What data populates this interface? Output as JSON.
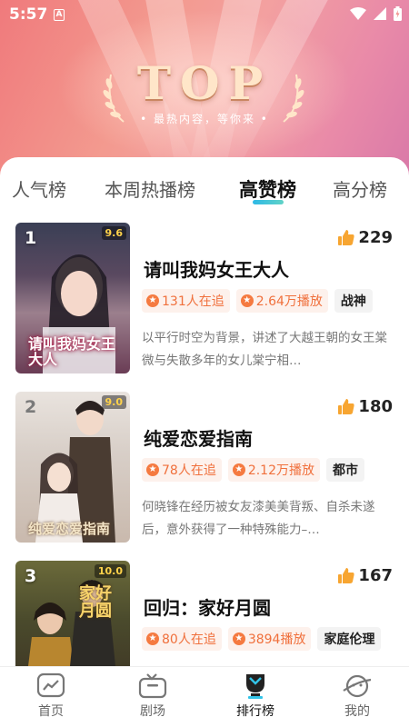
{
  "status_bar": {
    "time": "5:57",
    "notification_badge": "A"
  },
  "hero": {
    "title": "TOP",
    "subtitle": "• 最热内容，等你来 •"
  },
  "tabs": [
    {
      "label": "人气榜",
      "active": false
    },
    {
      "label": "本周热播榜",
      "active": false
    },
    {
      "label": "高赞榜",
      "active": true
    },
    {
      "label": "高分榜",
      "active": false
    }
  ],
  "items": [
    {
      "rank": "1",
      "score": "9.6",
      "cover_text": "请叫我妈女王大人",
      "likes": "229",
      "title": "请叫我妈女王大人",
      "followers": "131人在追",
      "plays": "2.64万播放",
      "genre": "战神",
      "desc": "以平行时空为背景，讲述了大越王朝的女王棠微与失散多年的女儿棠宁相…"
    },
    {
      "rank": "2",
      "score": "9.0",
      "cover_text": "纯爱恋爱指南",
      "likes": "180",
      "title": "纯爱恋爱指南",
      "followers": "78人在追",
      "plays": "2.12万播放",
      "genre": "都市",
      "desc": "何晓锋在经历被女友漆美美背叛、自杀未遂后，意外获得了一种特殊能力–…"
    },
    {
      "rank": "3",
      "score": "10.0",
      "cover_text": "家好月圆",
      "likes": "167",
      "title": "回归：家好月圆",
      "followers": "80人在追",
      "plays": "3894播放",
      "genre": "家庭伦理",
      "desc": ""
    }
  ],
  "bottom_nav": [
    {
      "label": "首页",
      "icon": "home-chart-icon",
      "active": false
    },
    {
      "label": "剧场",
      "icon": "tv-icon",
      "active": false
    },
    {
      "label": "排行榜",
      "icon": "ranking-trophy-icon",
      "active": true
    },
    {
      "label": "我的",
      "icon": "profile-planet-icon",
      "active": false
    }
  ],
  "colors": {
    "accent_orange": "#f0703c",
    "tab_underline": "#2db8e6",
    "like_icon": "#f7a531",
    "nav_active": "#1fa8d6"
  }
}
